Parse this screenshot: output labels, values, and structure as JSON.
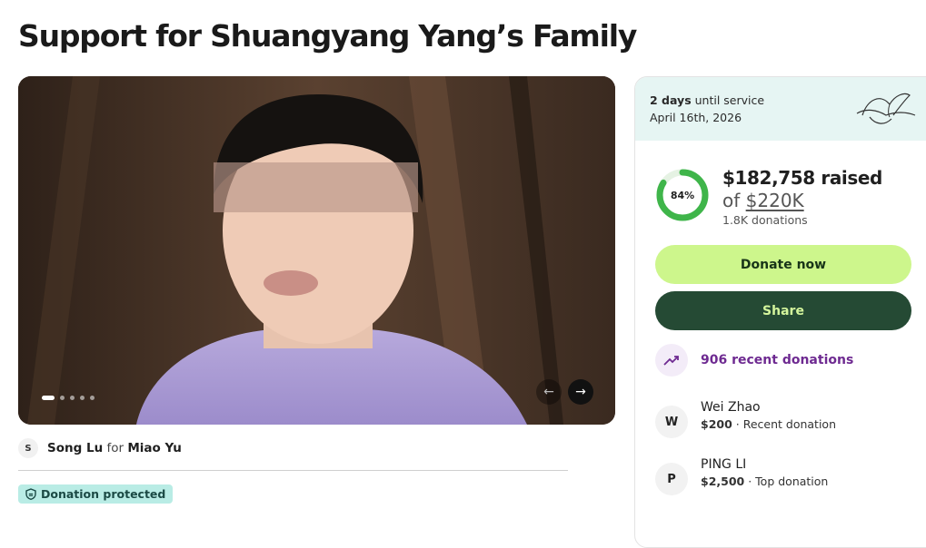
{
  "page": {
    "title": "Support for Shuangyang Yang’s Family"
  },
  "gallery": {
    "slide_count": 5,
    "active_slide": 1
  },
  "organizer": {
    "initial": "S",
    "name": "Song Lu",
    "connector": "for",
    "beneficiary": "Miao Yu"
  },
  "badge": {
    "label": "Donation protected"
  },
  "service": {
    "days": "2 days",
    "suffix": "until service",
    "date": "April 16th, 2026"
  },
  "progress": {
    "percent_label": "84%",
    "percent": 84,
    "raised": "$182,758 raised",
    "of": "of",
    "goal": "$220K",
    "donations": "1.8K donations"
  },
  "buttons": {
    "donate": "Donate now",
    "share": "Share"
  },
  "recent": {
    "label": "906 recent donations"
  },
  "donors": [
    {
      "initial": "W",
      "name": "Wei Zhao",
      "amount": "$200",
      "note": " · Recent donation"
    },
    {
      "initial": "P",
      "name": "PING LI",
      "amount": "$2,500",
      "note": " · Top donation"
    }
  ],
  "colors": {
    "progress_ring": "#3fb54a",
    "donate_bg": "#cdf68c",
    "share_bg": "#254a34",
    "recent_accent": "#6e2a91"
  }
}
